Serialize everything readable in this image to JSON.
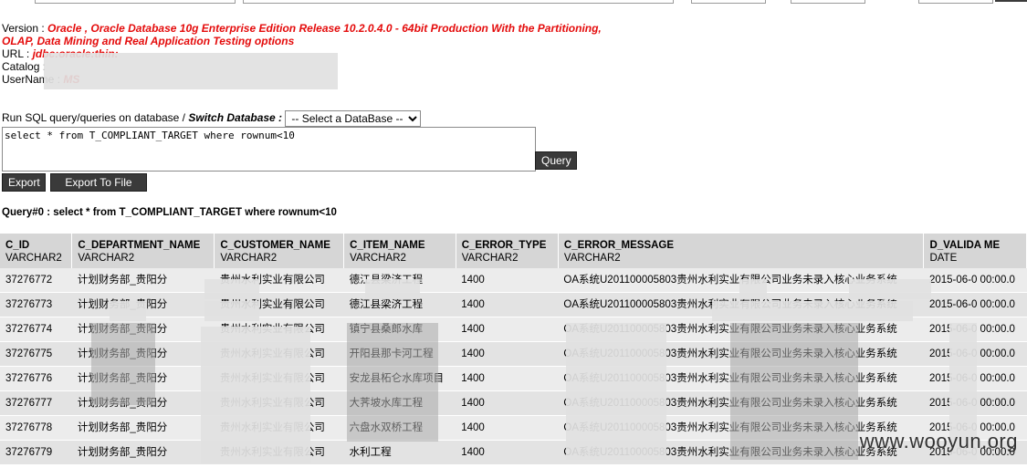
{
  "connection": {
    "version_label": "Version : ",
    "version_value": "Oracle , Oracle Database 10g Enterprise Edition Release 10.2.0.4.0 - 64bit Production With the Partitioning, OLAP, Data Mining and Real Application Testing options",
    "url_label": "URL : ",
    "url_value": "jdbc:oracle:thin:",
    "catalog_label": "Catalog : ",
    "catalog_value": "",
    "username_label": "UserName : ",
    "username_value": "MS"
  },
  "query_panel": {
    "run_label": "Run SQL query/queries on database / ",
    "switch_label": "Switch Database :",
    "database_select_value": "-- Select a DataBase --",
    "sql_text": "select * from T_COMPLIANT_TARGET where rownum<10",
    "query_button": "Query",
    "export_button": "Export",
    "export_file_button": "Export To File"
  },
  "result_title": "Query#0 : select * from T_COMPLIANT_TARGET where rownum<10",
  "table": {
    "columns": [
      {
        "name": "C_ID",
        "type": "VARCHAR2"
      },
      {
        "name": "C_DEPARTMENT_NAME",
        "type": "VARCHAR2"
      },
      {
        "name": "C_CUSTOMER_NAME",
        "type": "VARCHAR2"
      },
      {
        "name": "C_ITEM_NAME",
        "type": "VARCHAR2"
      },
      {
        "name": "C_ERROR_TYPE",
        "type": "VARCHAR2"
      },
      {
        "name": "C_ERROR_MESSAGE",
        "type": "VARCHAR2"
      },
      {
        "name": "D_VALIDA      ME",
        "type": "DATE"
      }
    ],
    "rows": [
      [
        "37276772",
        "计划财务部_贵阳分",
        "贵州水利实业有限公司",
        "德江县梁济工程",
        "1400",
        "OA系统U201100005803贵州水利实业有限公司业务未录入核心业务系统",
        "2015-06-0 00:00.0"
      ],
      [
        "37276773",
        "计划财务部_贵阳分",
        "贵州水利实业有限公司",
        "德江县梁济工程",
        "1400",
        "OA系统U201100005803贵州水利实业有限公司业务未录入核心业务系统",
        "2015-06-0 00:00.0"
      ],
      [
        "37276774",
        "计划财务部_贵阳分",
        "贵州水利实业有限公司",
        "镇宁县桑郎水库",
        "1400",
        "OA系统U201100005803贵州水利实业有限公司业务未录入核心业务系统",
        "2015-06-0 00:00.0"
      ],
      [
        "37276775",
        "计划财务部_贵阳分",
        "贵州水利实业有限公司",
        "开阳县那卡河工程",
        "1400",
        "OA系统U201100005803贵州水利实业有限公司业务未录入核心业务系统",
        "2015-06-0 00:00.0"
      ],
      [
        "37276776",
        "计划财务部_贵阳分",
        "贵州水利实业有限公司",
        "安龙县柘仑水库项目",
        "1400",
        "OA系统U201100005803贵州水利实业有限公司业务未录入核心业务系统",
        "2015-06-0 00:00.0"
      ],
      [
        "37276777",
        "计划财务部_贵阳分",
        "贵州水利实业有限公司",
        "大荠坡水库工程",
        "1400",
        "OA系统U201100005803贵州水利实业有限公司业务未录入核心业务系统",
        "2015-06-0 00:00.0"
      ],
      [
        "37276778",
        "计划财务部_贵阳分",
        "贵州水利实业有限公司",
        "六盘水双桥工程",
        "1400",
        "OA系统U201100005803贵州水利实业有限公司业务未录入核心业务系统",
        "2015-06-0 00:00.0"
      ],
      [
        "37276779",
        "计划财务部_贵阳分",
        "贵州水利实业有限公司",
        "水利工程",
        "1400",
        "OA系统U201100005803贵州水利实业有限公司业务未录入核心业务系统",
        "2015-06-0 00:00.0"
      ]
    ]
  },
  "watermark": "www.wooyun.org"
}
